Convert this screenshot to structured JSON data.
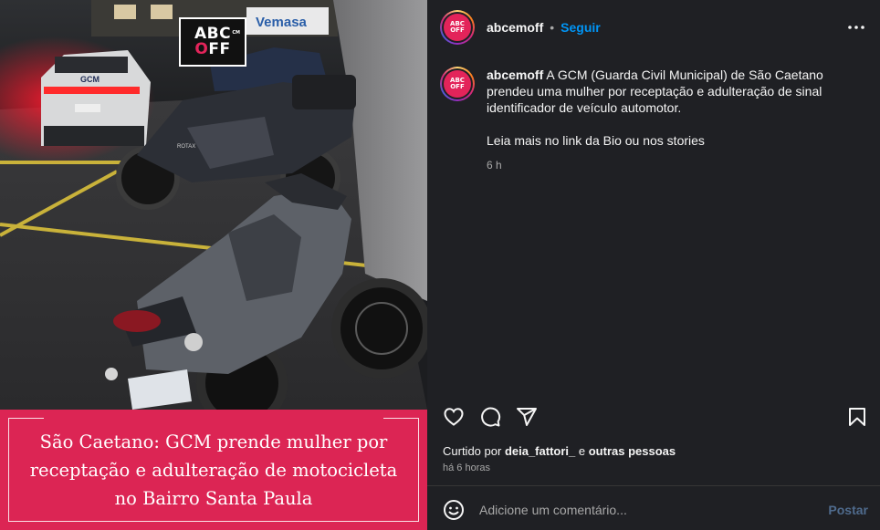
{
  "media": {
    "logo": {
      "line1": "ABC",
      "line2_o": "O",
      "line2_rest": "FF",
      "mark": "CM"
    },
    "headline": "São Caetano: GCM prende mulher por receptação e adulteração de motocicleta no Bairro Santa Paula",
    "headline_bg": "#dc2554",
    "scene_texts": {
      "storefront_sign": "Vemasa",
      "vehicle_label": "GCM",
      "bike_brand": "ROTAX"
    }
  },
  "post": {
    "username": "abcemoff",
    "follow_label": "Seguir",
    "avatar_text": "ABC OFF",
    "more_icon": "more-horizontal-icon",
    "caption": {
      "username": "abcemoff",
      "text": "A GCM (Guarda Civil Municipal) de São Caetano prendeu uma mulher por receptação e adulteração de sinal identificador de veículo automotor.",
      "more": "Leia mais no link da Bio ou nos stories",
      "time": "6 h"
    },
    "actions": {
      "like": "heart-icon",
      "comment": "comment-bubble-icon",
      "share": "send-icon",
      "save": "bookmark-icon"
    },
    "likes": {
      "prefix": "Curtido por",
      "user": "deia_fattori_",
      "connector": "e",
      "others": "outras pessoas"
    },
    "posted_time": "há 6 horas",
    "comment": {
      "emoji_icon": "emoji-icon",
      "placeholder": "Adicione um comentário...",
      "post_label": "Postar"
    }
  },
  "colors": {
    "panel_bg": "#1f2024",
    "follow_blue": "#0095f6",
    "accent_pink": "#dc2554"
  }
}
